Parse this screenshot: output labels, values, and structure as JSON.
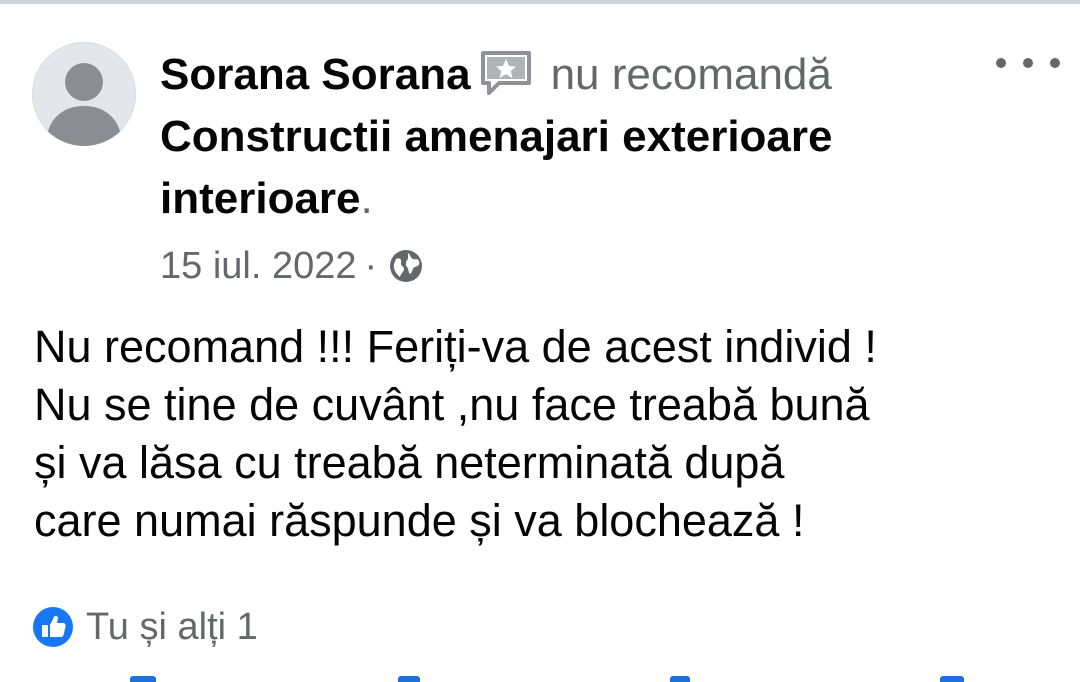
{
  "post": {
    "author": "Sorana Sorana",
    "action": "nu recomandă",
    "page_name": "Constructii amenajari exterioare interioare",
    "period": ".",
    "date": "15 iul. 2022",
    "separator": "·",
    "privacy_icon": "globe-icon",
    "badge_icon": "review-badge-icon",
    "more_icon": "more-options-icon",
    "body": "Nu recomand !!! Feriți-va de acest individ !\nNu se tine de cuvânt ,nu face treabă bună\nși va lăsa cu treabă neterminată după\ncare numai răspunde și va blochează !",
    "reactions": {
      "icon": "like-icon",
      "text": "Tu și alți 1"
    }
  },
  "colors": {
    "primary_text": "#050505",
    "secondary_text": "#65676b",
    "like_blue": "#1877f2",
    "avatar_bg": "#e4e6eb",
    "avatar_figure": "#8a8d91"
  }
}
